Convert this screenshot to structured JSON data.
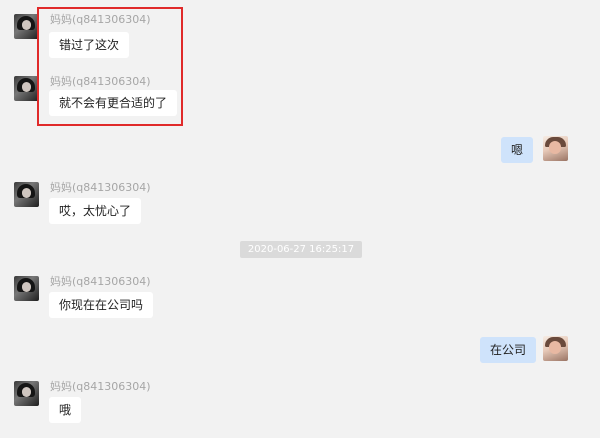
{
  "contact": {
    "nickname": "妈妈(q841306304)"
  },
  "messages": [
    {
      "sender": "contact",
      "text": "错过了这次"
    },
    {
      "sender": "contact",
      "text": "就不会有更合适的了"
    },
    {
      "sender": "self",
      "text": "嗯"
    },
    {
      "sender": "contact",
      "text": "哎，太忧心了"
    },
    {
      "sender": "contact",
      "text": "你现在在公司吗"
    },
    {
      "sender": "self",
      "text": "在公司"
    },
    {
      "sender": "contact",
      "text": "哦"
    }
  ],
  "timestamp": "2020-06-27 16:25:17",
  "colors": {
    "highlight": "#e02a2a",
    "self_bubble": "#cfe3fb",
    "contact_bubble": "#ffffff",
    "background": "#f2f2f2"
  }
}
